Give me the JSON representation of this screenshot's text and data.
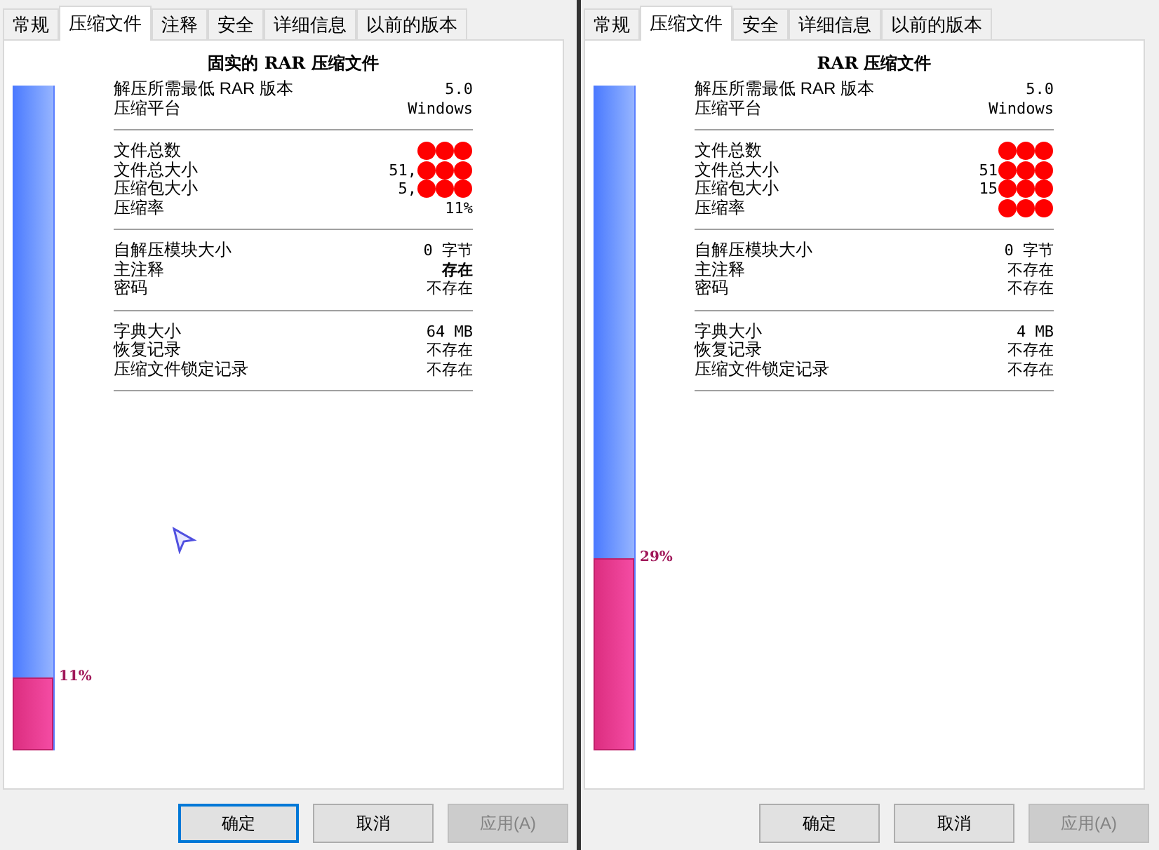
{
  "panels": [
    {
      "tabs": [
        {
          "label": "常规",
          "selected": false
        },
        {
          "label": "压缩文件",
          "selected": true
        },
        {
          "label": "注释",
          "selected": false
        },
        {
          "label": "安全",
          "selected": false
        },
        {
          "label": "详细信息",
          "selected": false
        },
        {
          "label": "以前的版本",
          "selected": false
        }
      ],
      "title": "固实的 RAR 压缩文件",
      "sections": [
        [
          {
            "label": "解压所需最低 RAR 版本",
            "value": "5.0",
            "bold": false,
            "redacted": false
          },
          {
            "label": "压缩平台",
            "value": "Windows",
            "bold": false,
            "redacted": false
          }
        ],
        [
          {
            "label": "文件总数",
            "redacted": true
          },
          {
            "label": "文件总大小",
            "value": "51,",
            "bold": false,
            "redacted": true
          },
          {
            "label": "压缩包大小",
            "value": "5,",
            "bold": false,
            "redacted": true
          },
          {
            "label": "压缩率",
            "value": "11%",
            "bold": false,
            "redacted": false
          }
        ],
        [
          {
            "label": "自解压模块大小",
            "value": "0 字节",
            "bold": false,
            "redacted": false
          },
          {
            "label": "主注释",
            "value": "存在",
            "bold": true,
            "redacted": false
          },
          {
            "label": "密码",
            "value": "不存在",
            "bold": false,
            "redacted": false
          }
        ],
        [
          {
            "label": "字典大小",
            "value": "64 MB",
            "bold": false,
            "redacted": false
          },
          {
            "label": "恢复记录",
            "value": "不存在",
            "bold": false,
            "redacted": false
          },
          {
            "label": "压缩文件锁定记录",
            "value": "不存在",
            "bold": false,
            "redacted": false
          }
        ]
      ],
      "ratio": {
        "level": 0.11,
        "label": "11%"
      },
      "buttons": [
        {
          "label": "确定",
          "kind": "default"
        },
        {
          "label": "取消",
          "kind": "normal"
        },
        {
          "label": "应用(A)",
          "kind": "disabled"
        }
      ]
    },
    {
      "tabs": [
        {
          "label": "常规",
          "selected": false
        },
        {
          "label": "压缩文件",
          "selected": true
        },
        {
          "label": "安全",
          "selected": false
        },
        {
          "label": "详细信息",
          "selected": false
        },
        {
          "label": "以前的版本",
          "selected": false
        }
      ],
      "title": "RAR 压缩文件",
      "sections": [
        [
          {
            "label": "解压所需最低 RAR 版本",
            "value": "5.0",
            "bold": false,
            "redacted": false
          },
          {
            "label": "压缩平台",
            "value": "Windows",
            "bold": false,
            "redacted": false
          }
        ],
        [
          {
            "label": "文件总数",
            "redacted": true
          },
          {
            "label": "文件总大小",
            "value": "51",
            "bold": false,
            "redacted": true
          },
          {
            "label": "压缩包大小",
            "value": "15",
            "bold": false,
            "redacted": true
          },
          {
            "label": "压缩率",
            "redacted": true
          }
        ],
        [
          {
            "label": "自解压模块大小",
            "value": "0 字节",
            "bold": false,
            "redacted": false
          },
          {
            "label": "主注释",
            "value": "不存在",
            "bold": false,
            "redacted": false
          },
          {
            "label": "密码",
            "value": "不存在",
            "bold": false,
            "redacted": false
          }
        ],
        [
          {
            "label": "字典大小",
            "value": "4 MB",
            "bold": false,
            "redacted": false
          },
          {
            "label": "恢复记录",
            "value": "不存在",
            "bold": false,
            "redacted": false
          },
          {
            "label": "压缩文件锁定记录",
            "value": "不存在",
            "bold": false,
            "redacted": false
          }
        ]
      ],
      "ratio": {
        "level": 0.29,
        "label": "29%"
      },
      "buttons": [
        {
          "label": "确定",
          "kind": "normal"
        },
        {
          "label": "取消",
          "kind": "normal"
        },
        {
          "label": "应用(A)",
          "kind": "disabled"
        }
      ]
    }
  ]
}
